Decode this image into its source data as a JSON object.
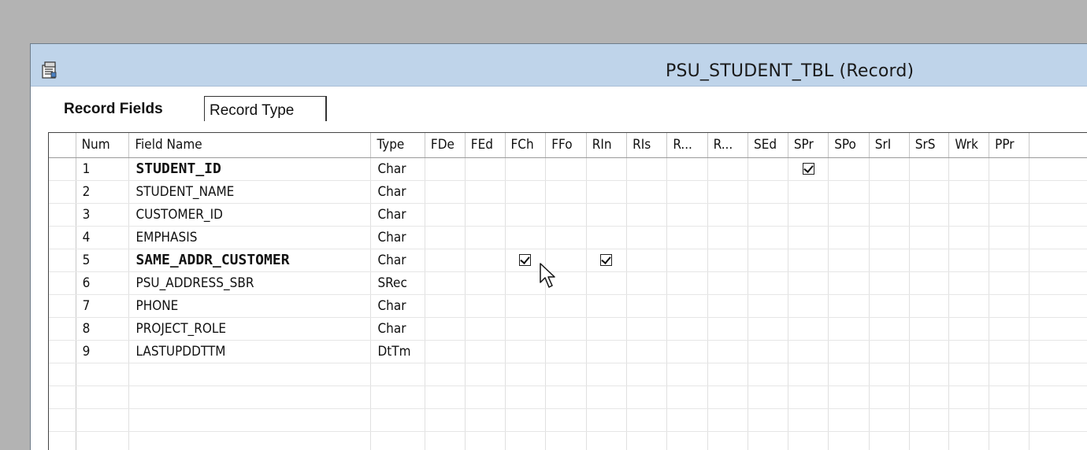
{
  "window": {
    "title": "PSU_STUDENT_TBL (Record)",
    "icon": "record-definition-icon"
  },
  "tabs": [
    {
      "label": "Record Fields",
      "selected": true
    },
    {
      "label": "Record Type",
      "selected": false
    }
  ],
  "grid": {
    "columns": [
      "Num",
      "Field Name",
      "Type",
      "FDe",
      "FEd",
      "FCh",
      "FFo",
      "RIn",
      "RIs",
      "R...",
      "R...",
      "SEd",
      "SPr",
      "SPo",
      "SrI",
      "SrS",
      "Wrk",
      "PPr"
    ],
    "rows": [
      {
        "num": "1",
        "name": "STUDENT_ID",
        "type": "Char",
        "bold": true,
        "checked": [
          "SPr"
        ]
      },
      {
        "num": "2",
        "name": "STUDENT_NAME",
        "type": "Char",
        "bold": false,
        "checked": []
      },
      {
        "num": "3",
        "name": "CUSTOMER_ID",
        "type": "Char",
        "bold": false,
        "checked": []
      },
      {
        "num": "4",
        "name": "EMPHASIS",
        "type": "Char",
        "bold": false,
        "checked": []
      },
      {
        "num": "5",
        "name": "SAME_ADDR_CUSTOMER",
        "type": "Char",
        "bold": true,
        "checked": [
          "FCh",
          "RIn"
        ]
      },
      {
        "num": "6",
        "name": "PSU_ADDRESS_SBR",
        "type": "SRec",
        "bold": false,
        "checked": []
      },
      {
        "num": "7",
        "name": "PHONE",
        "type": "Char",
        "bold": false,
        "checked": []
      },
      {
        "num": "8",
        "name": "PROJECT_ROLE",
        "type": "Char",
        "bold": false,
        "checked": []
      },
      {
        "num": "9",
        "name": "LASTUPDDTTM",
        "type": "DtTm",
        "bold": false,
        "checked": []
      }
    ]
  },
  "colors": {
    "desktop": "#b3b3b3",
    "titlebar": "#bfd4ea",
    "grid_line": "#e0e0e0"
  }
}
